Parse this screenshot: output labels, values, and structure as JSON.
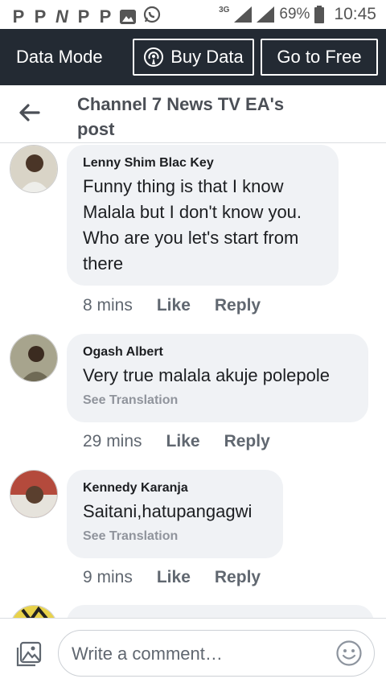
{
  "statusbar": {
    "icons": [
      "p-app-icon",
      "p-app-icon",
      "network-icon",
      "p-app-icon",
      "p-app-icon",
      "gallery-icon",
      "whatsapp-icon"
    ],
    "app_letter": "P",
    "network_letter": "N",
    "network_type": "3G",
    "battery": "69%",
    "time": "10:45"
  },
  "banner": {
    "title": "Data Mode",
    "buy_label": "Buy Data",
    "free_label": "Go to Free",
    "bg_color": "#232a33"
  },
  "header": {
    "title": "Channel 7 News TV EA's post"
  },
  "comments": [
    {
      "name": "Lenny Shim Blac Key",
      "text": "Funny thing is that I know Malala but I don't know you. Who are you let's start from there",
      "time": "8 mins",
      "like": "Like",
      "reply": "Reply"
    },
    {
      "name": "Ogash Albert",
      "text": "Very true malala akuje polepole",
      "translation": "See Translation",
      "time": "29 mins",
      "like": "Like",
      "reply": "Reply"
    },
    {
      "name": "Kennedy Karanja",
      "text": "Saitani,hatupangagwi",
      "translation": "See Translation",
      "time": "9 mins",
      "like": "Like",
      "reply": "Reply"
    }
  ],
  "composer": {
    "placeholder": "Write a comment…"
  }
}
